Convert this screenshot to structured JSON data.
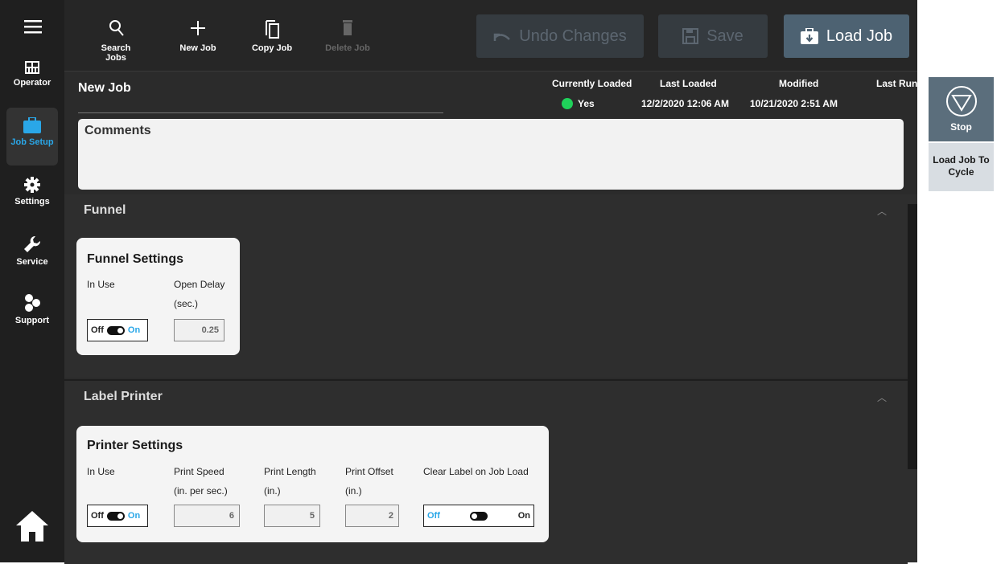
{
  "sidebar": {
    "menu_icon": "hamburger-icon",
    "items": [
      {
        "label": "Operator",
        "icon": "grid-icon"
      },
      {
        "label": "Job Setup",
        "icon": "briefcase-icon"
      },
      {
        "label": "Settings",
        "icon": "gear-icon"
      },
      {
        "label": "Service",
        "icon": "wrench-icon"
      },
      {
        "label": "Support",
        "icon": "hexagons-icon"
      }
    ],
    "home_icon": "home-icon"
  },
  "toolbar": {
    "search_label": "Search Jobs",
    "new_label": "New Job",
    "copy_label": "Copy Job",
    "delete_label": "Delete Job",
    "undo_label": "Undo Changes",
    "save_label": "Save",
    "load_label": "Load Job"
  },
  "job": {
    "name": "New Job",
    "currently_loaded_label": "Currently Loaded",
    "currently_loaded_value": "Yes",
    "last_loaded_label": "Last Loaded",
    "last_loaded_value": "12/2/2020 12:06 AM",
    "modified_label": "Modified",
    "modified_value": "10/21/2020 2:51 AM",
    "last_run_label": "Last Run",
    "status_color": "#1fd15a"
  },
  "comments": {
    "label": "Comments"
  },
  "funnel": {
    "section_title": "Funnel",
    "card_title": "Funnel Settings",
    "in_use_label": "In Use",
    "open_delay_label": "Open Delay",
    "open_delay_unit": "(sec.)",
    "open_delay_value": "0.25",
    "toggle_off": "Off",
    "toggle_on": "On"
  },
  "label_printer": {
    "section_title": "Label Printer",
    "card_title": "Printer Settings",
    "in_use_label": "In Use",
    "print_speed_label": "Print Speed",
    "print_speed_unit": "(in. per sec.)",
    "print_speed_value": "6",
    "print_length_label": "Print Length",
    "print_length_unit": "(in.)",
    "print_length_value": "5",
    "print_offset_label": "Print Offset",
    "print_offset_unit": "(in.)",
    "print_offset_value": "2",
    "clear_label": "Clear Label on Job Load",
    "toggle_off": "Off",
    "toggle_on": "On"
  },
  "right_panel": {
    "stop_label": "Stop",
    "load_cycle_label": "Load Job To Cycle"
  }
}
